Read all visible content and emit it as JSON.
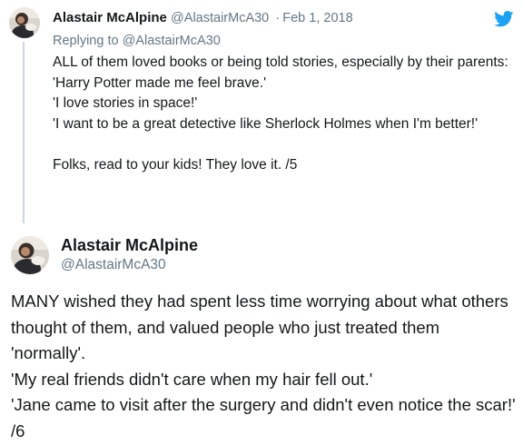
{
  "reply_tweet": {
    "author_name": "Alastair McAlpine",
    "author_handle": "@AlastairMcA30",
    "separator": "·",
    "date": "Feb 1, 2018",
    "replying_to_label": "Replying to",
    "replying_to_handle": "@AlastairMcA30",
    "lines": [
      "ALL of them loved books or being told stories, especially by their parents:",
      "'Harry Potter made me feel brave.'",
      "'I love stories in space!'",
      "'I want to be a great detective like Sherlock Holmes when I'm better!'",
      "",
      "Folks, read to your kids! They love it. /5"
    ],
    "brand_icon": "twitter-bird-icon",
    "brand_color": "#1da1f2"
  },
  "main_tweet": {
    "author_name": "Alastair McAlpine",
    "author_handle": "@AlastairMcA30",
    "lines": [
      "MANY wished they had spent less time worrying about what others thought of them, and valued people who just treated them 'normally'.",
      "'My real friends didn't care when my hair fell out.'",
      "'Jane came to visit after the surgery and didn't even notice the scar!' /6"
    ]
  },
  "colors": {
    "text_primary": "#14171a",
    "text_secondary": "#657786",
    "thread_line": "#ccd6dd"
  }
}
